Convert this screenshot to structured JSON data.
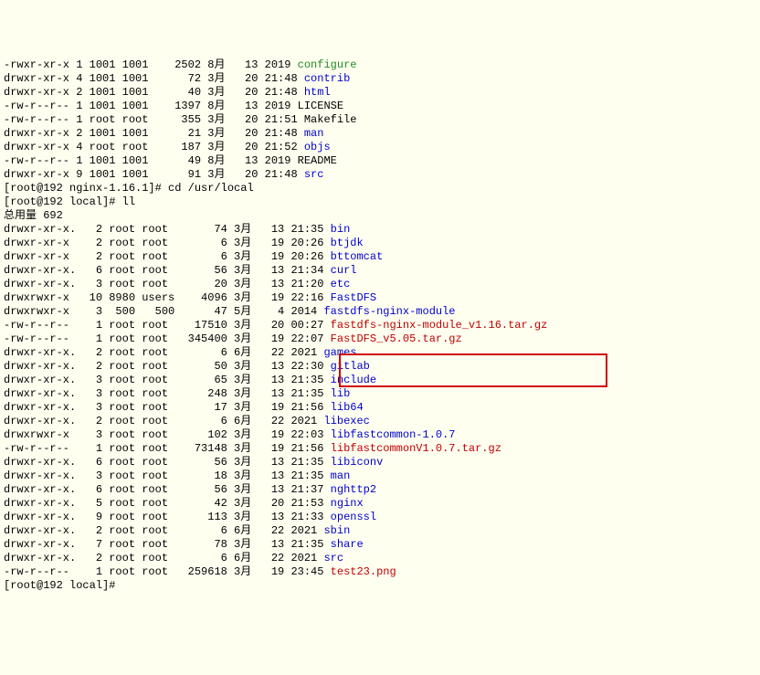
{
  "lines": [
    {
      "perm": "-rwxr-xr-x 1 1001 1001    2502 8月   13 2019 ",
      "name": "configure",
      "cls": "green"
    },
    {
      "perm": "drwxr-xr-x 4 1001 1001      72 3月   20 21:48 ",
      "name": "contrib",
      "cls": "blue"
    },
    {
      "perm": "drwxr-xr-x 2 1001 1001      40 3月   20 21:48 ",
      "name": "html",
      "cls": "blue"
    },
    {
      "perm": "-rw-r--r-- 1 1001 1001    1397 8月   13 2019 LICENSE",
      "name": "",
      "cls": ""
    },
    {
      "perm": "-rw-r--r-- 1 root root     355 3月   20 21:51 Makefile",
      "name": "",
      "cls": ""
    },
    {
      "perm": "drwxr-xr-x 2 1001 1001      21 3月   20 21:48 ",
      "name": "man",
      "cls": "blue"
    },
    {
      "perm": "drwxr-xr-x 4 root root     187 3月   20 21:52 ",
      "name": "objs",
      "cls": "blue"
    },
    {
      "perm": "-rw-r--r-- 1 1001 1001      49 8月   13 2019 README",
      "name": "",
      "cls": ""
    },
    {
      "perm": "drwxr-xr-x 9 1001 1001      91 3月   20 21:48 ",
      "name": "src",
      "cls": "blue"
    }
  ],
  "cmd1": "[root@192 nginx-1.16.1]# cd /usr/local",
  "cmd2": "[root@192 local]# ll",
  "total": "总用量 692",
  "ls": [
    {
      "perm": "drwxr-xr-x.   2 root root       74 3月   13 21:35 ",
      "name": "bin",
      "cls": "blue"
    },
    {
      "perm": "drwxr-xr-x    2 root root        6 3月   19 20:26 ",
      "name": "btjdk",
      "cls": "blue"
    },
    {
      "perm": "drwxr-xr-x    2 root root        6 3月   19 20:26 ",
      "name": "bttomcat",
      "cls": "blue"
    },
    {
      "perm": "drwxr-xr-x.   6 root root       56 3月   13 21:34 ",
      "name": "curl",
      "cls": "blue"
    },
    {
      "perm": "drwxr-xr-x.   3 root root       20 3月   13 21:20 ",
      "name": "etc",
      "cls": "blue"
    },
    {
      "perm": "drwxrwxr-x   10 8980 users    4096 3月   19 22:16 ",
      "name": "FastDFS",
      "cls": "blue"
    },
    {
      "perm": "drwxrwxr-x    3  500   500      47 5月    4 2014 ",
      "name": "fastdfs-nginx-module",
      "cls": "blue"
    },
    {
      "perm": "-rw-r--r--    1 root root    17510 3月   20 00:27 ",
      "name": "fastdfs-nginx-module_v1.16.tar.gz",
      "cls": "red"
    },
    {
      "perm": "-rw-r--r--    1 root root   345400 3月   19 22:07 ",
      "name": "FastDFS_v5.05.tar.gz",
      "cls": "red"
    },
    {
      "perm": "drwxr-xr-x.   2 root root        6 6月   22 2021 ",
      "name": "games",
      "cls": "blue"
    },
    {
      "perm": "drwxr-xr-x.   2 root root       50 3月   13 22:30 ",
      "name": "gitlab",
      "cls": "blue"
    },
    {
      "perm": "drwxr-xr-x.   3 root root       65 3月   13 21:35 ",
      "name": "include",
      "cls": "blue"
    },
    {
      "perm": "drwxr-xr-x.   3 root root      248 3月   13 21:35 ",
      "name": "lib",
      "cls": "blue"
    },
    {
      "perm": "drwxr-xr-x.   3 root root       17 3月   19 21:56 ",
      "name": "lib64",
      "cls": "blue"
    },
    {
      "perm": "drwxr-xr-x.   2 root root        6 6月   22 2021 ",
      "name": "libexec",
      "cls": "blue"
    },
    {
      "perm": "drwxrwxr-x    3 root root      102 3月   19 22:03 ",
      "name": "libfastcommon-1.0.7",
      "cls": "blue"
    },
    {
      "perm": "-rw-r--r--    1 root root    73148 3月   19 21:56 ",
      "name": "libfastcommonV1.0.7.tar.gz",
      "cls": "red"
    },
    {
      "perm": "drwxr-xr-x.   6 root root       56 3月   13 21:35 ",
      "name": "libiconv",
      "cls": "blue"
    },
    {
      "perm": "drwxr-xr-x.   3 root root       18 3月   13 21:35 ",
      "name": "man",
      "cls": "blue"
    },
    {
      "perm": "drwxr-xr-x.   6 root root       56 3月   13 21:37 ",
      "name": "nghttp2",
      "cls": "blue"
    },
    {
      "perm": "drwxr-xr-x.   5 root root       42 3月   20 21:53 ",
      "name": "nginx",
      "cls": "blue"
    },
    {
      "perm": "drwxr-xr-x.   9 root root      113 3月   13 21:33 ",
      "name": "openssl",
      "cls": "blue"
    },
    {
      "perm": "drwxr-xr-x.   2 root root        6 6月   22 2021 ",
      "name": "sbin",
      "cls": "blue"
    },
    {
      "perm": "drwxr-xr-x.   7 root root       78 3月   13 21:35 ",
      "name": "share",
      "cls": "blue"
    },
    {
      "perm": "drwxr-xr-x.   2 root root        6 6月   22 2021 ",
      "name": "src",
      "cls": "blue"
    },
    {
      "perm": "-rw-r--r--    1 root root   259618 3月   19 23:45 ",
      "name": "test23.png",
      "cls": "red"
    }
  ],
  "cmd3": "[root@192 local]# "
}
